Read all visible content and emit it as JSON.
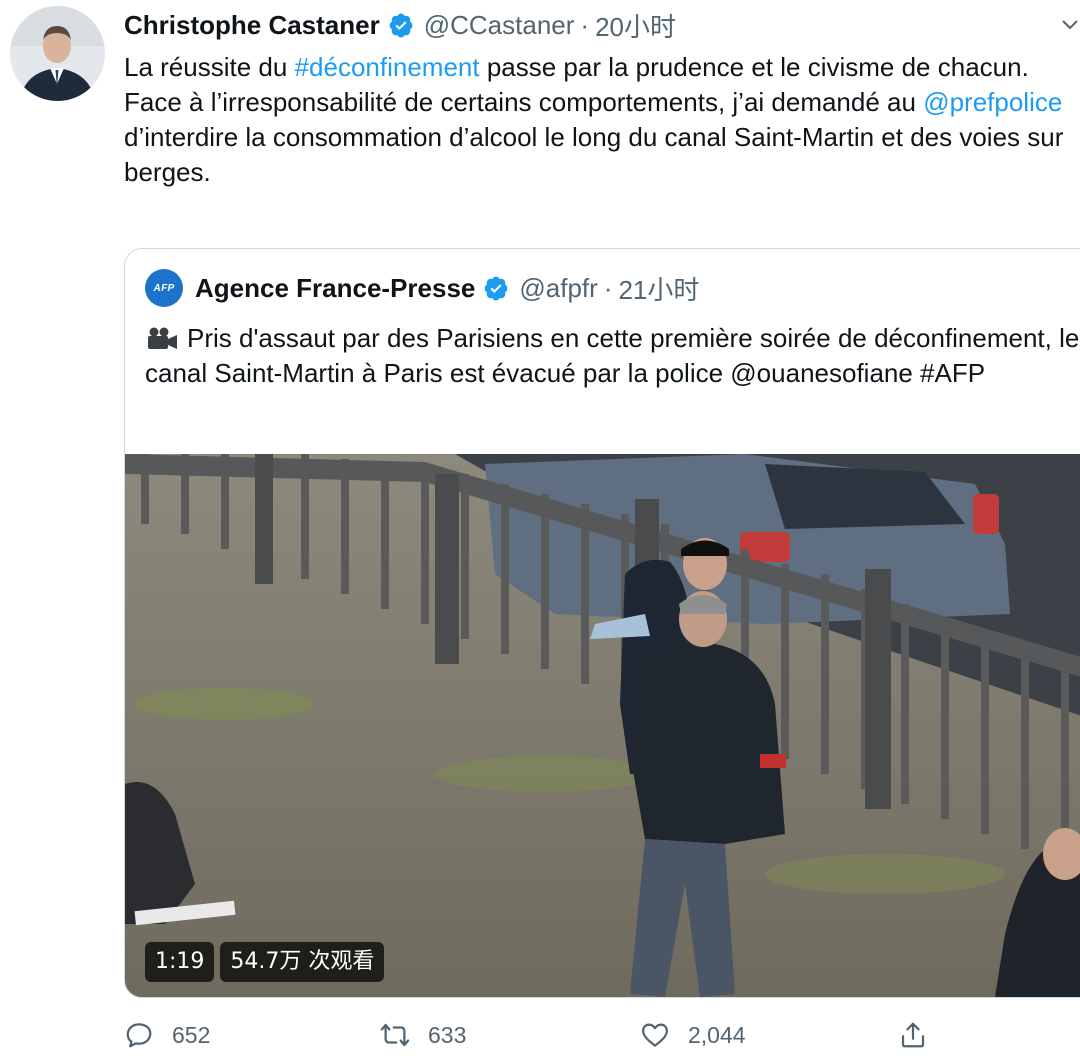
{
  "tweet": {
    "author_name": "Christophe Castaner",
    "handle": "@CCastaner",
    "separator": "·",
    "time": "20小时",
    "text_line1_before": "La réussite du ",
    "text_hashtag": "#déconfinement",
    "text_line1_after": " passe par la prudence et le civisme de chacun.",
    "text_line2_before": "Face à l’irresponsabilité de certains comportements, j’ai demandé au ",
    "text_mention": "@prefpolice",
    "text_line2_after": " d’interdire la consommation d’alcool le long du canal Saint-Martin et des voies sur berges."
  },
  "quoted_tweet": {
    "logo_text": "AFP",
    "author_name": "Agence France-Presse",
    "handle": "@afpfr",
    "separator": "·",
    "time": "21小时",
    "text": "Pris d'assaut par des Parisiens en cette première soirée de déconfinement, le canal Saint-Martin à Paris est évacué par la police @ouanesofiane #AFP",
    "video": {
      "duration": "1:19",
      "views": "54.7万 次观看"
    }
  },
  "actions": {
    "replies": "652",
    "retweets": "633",
    "likes": "2,044"
  },
  "colors": {
    "link": "#1d9bf0",
    "verified": "#1d9bf0",
    "secondary_text": "#536471",
    "border": "#cfd9de"
  }
}
